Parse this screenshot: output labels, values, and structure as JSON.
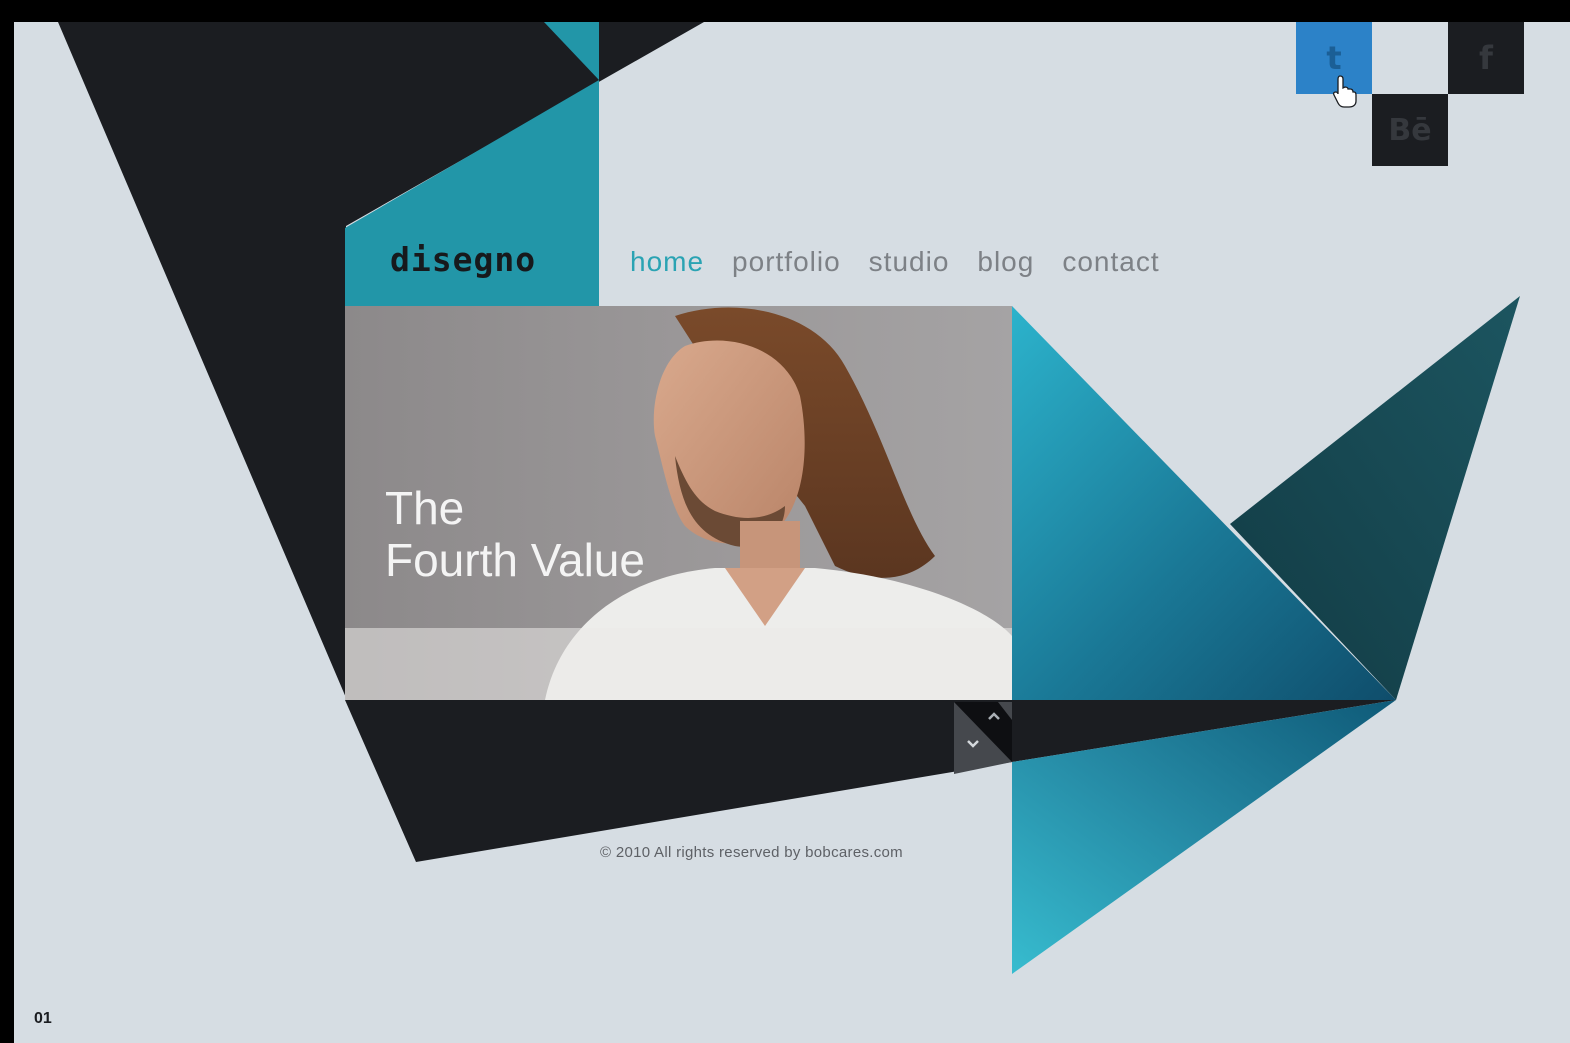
{
  "site": {
    "logo": "disegno"
  },
  "nav": {
    "items": [
      {
        "label": "home",
        "active": true
      },
      {
        "label": "portfolio",
        "active": false
      },
      {
        "label": "studio",
        "active": false
      },
      {
        "label": "blog",
        "active": false
      },
      {
        "label": "contact",
        "active": false
      }
    ]
  },
  "hero": {
    "title_line1": "The",
    "title_line2": "Fourth Value"
  },
  "social": {
    "twitter": "t",
    "facebook": "f",
    "behance": "Bē"
  },
  "footer": {
    "copyright": "© 2010 All rights reserved by bobcares.com"
  },
  "figure_label": "01",
  "colors": {
    "teal": "#2296a8",
    "dark": "#1b1d21",
    "background": "#d6dde3",
    "twitter_blue": "#2c82c8",
    "nav_active": "#2aa3b3"
  }
}
